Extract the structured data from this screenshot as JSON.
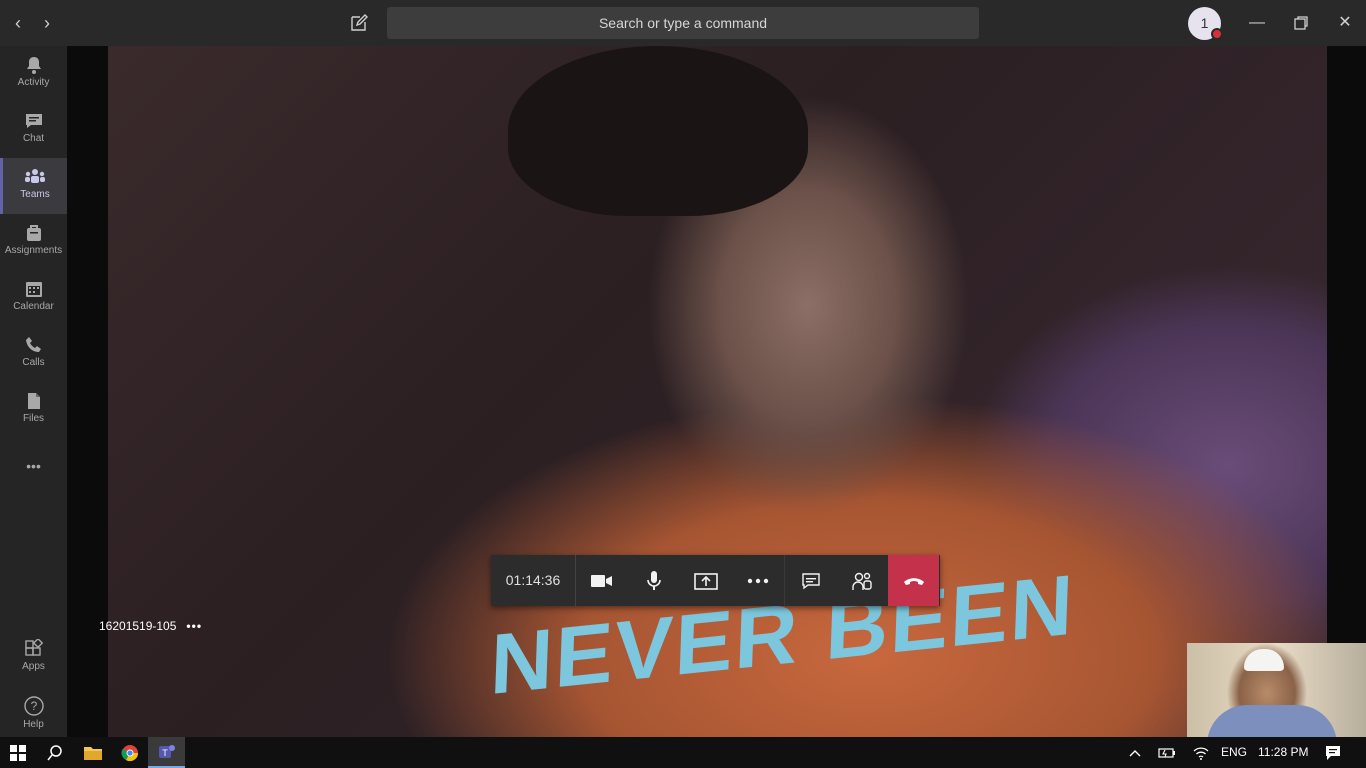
{
  "titlebar": {
    "search_placeholder": "Search or type a command",
    "avatar_initial": "1",
    "back_glyph": "‹",
    "forward_glyph": "›",
    "minimize_glyph": "—",
    "restore_glyph": "❐",
    "close_glyph": "✕"
  },
  "rail": {
    "items": [
      {
        "label": "Activity",
        "icon": "bell-icon"
      },
      {
        "label": "Chat",
        "icon": "chat-icon"
      },
      {
        "label": "Teams",
        "icon": "teams-icon",
        "active": true
      },
      {
        "label": "Assignments",
        "icon": "assignments-icon"
      },
      {
        "label": "Calendar",
        "icon": "calendar-icon"
      },
      {
        "label": "Calls",
        "icon": "phone-icon"
      },
      {
        "label": "Files",
        "icon": "file-icon"
      }
    ],
    "more_glyph": "•••",
    "bottom": [
      {
        "label": "Apps",
        "icon": "apps-icon"
      },
      {
        "label": "Help",
        "icon": "help-icon"
      }
    ]
  },
  "call": {
    "participant_name": "16201519-105",
    "participant_more": "•••",
    "timer": "01:14:36",
    "video_text": "NEVER BEEN",
    "controls": [
      "camera-icon",
      "microphone-icon",
      "share-screen-icon",
      "more-options-icon",
      "show-conversation-icon",
      "participants-icon",
      "hang-up-icon"
    ],
    "hangup_color": "#c4314b"
  },
  "taskbar": {
    "language": "ENG",
    "time": "11:28 PM",
    "apps": [
      "windows-start-icon",
      "search-icon",
      "file-explorer-icon",
      "chrome-icon",
      "teams-icon"
    ]
  },
  "colors": {
    "accent": "#6264a7",
    "titlebar": "#292929",
    "rail": "#252526"
  }
}
